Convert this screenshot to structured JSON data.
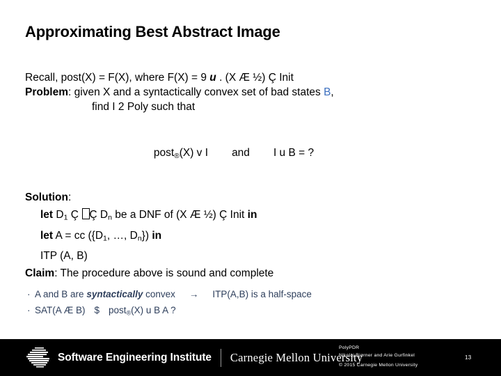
{
  "slide": {
    "title": "Approximating Best Abstract Image",
    "recall": {
      "prefix": "Recall, post(X) = F(X), where F(X) = 9 ",
      "quantified_var": "u",
      "suffix": " . (X Æ ½) Ç Init"
    },
    "problem": {
      "label": "Problem",
      "text": ": given X and a syntactically convex set of bad states ",
      "bad_states_symbol": "B",
      "trailing": ",",
      "second_line": "find I 2 Poly such that"
    },
    "formula": {
      "left_base": "post",
      "left_subscript": "®",
      "left_rest": "(X) v I",
      "conjunction": "and",
      "right": "I u B = ?"
    },
    "solution": {
      "label": "Solution",
      "colon": ":",
      "lines": [
        {
          "keyword": "let",
          "before_tofu": " D",
          "sub1": "1",
          "mid": " Ç ",
          "after_tofu": "Ç D",
          "subn": "n",
          "tail": " be a DNF of (X Æ ½) Ç Init  ",
          "keyword_end": "in"
        },
        {
          "keyword": "let",
          "text_a": " A = cc ({D",
          "sub1": "1",
          "text_b": ", …, D",
          "subn": "n",
          "text_c": "}) ",
          "keyword_end": "in"
        },
        {
          "plain": "ITP (A, B)"
        }
      ],
      "claim_label": "Claim",
      "claim_text": ": The procedure above is sound and complete"
    },
    "sub_bullets": [
      {
        "bullet": "·",
        "part1": "A and B are ",
        "emph": "syntactically",
        "part2": " convex",
        "arrow": "→",
        "part3": "ITP(A,B) is a half-space"
      },
      {
        "bullet": "·",
        "part1": "SAT(A Æ B)",
        "symbol": "$",
        "post_base": "post",
        "post_sub": "®",
        "part2": "(X) u B A ?"
      }
    ]
  },
  "footer": {
    "sei_name": "Software Engineering Institute",
    "cmu_name": "Carnegie Mellon University",
    "credit_title": "PolyPDR",
    "credit_authors": "Nikolaj Bjørner and Arie Gurfinkel",
    "copyright": "© 2015 Carnegie Mellon University",
    "page_number": "13"
  },
  "colors": {
    "bad_states_blue": "#3c6fbf",
    "sub_bullet_navy": "#2e3f5c",
    "footer_bg": "#000000",
    "text": "#000000"
  }
}
